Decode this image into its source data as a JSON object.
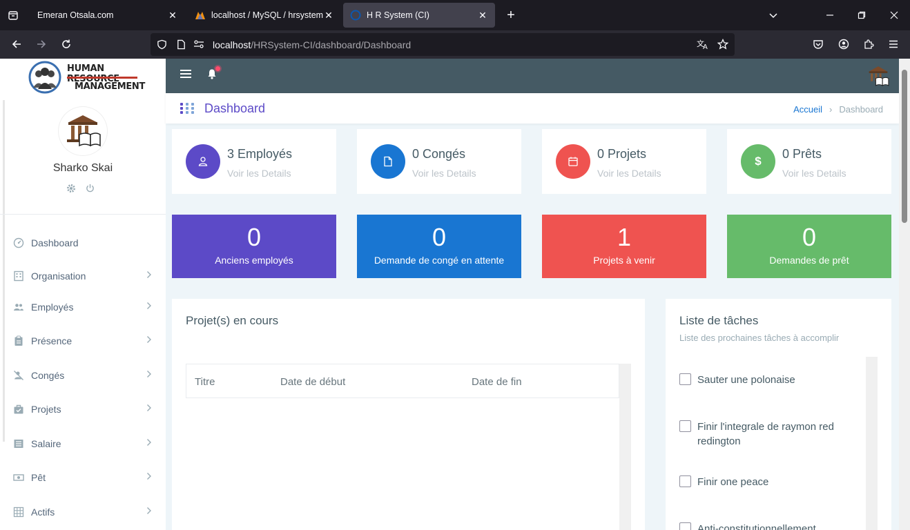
{
  "browser": {
    "tabs": [
      {
        "title": "Emeran Otsala.com",
        "active": false
      },
      {
        "title": "localhost / MySQL / hrsystemci",
        "active": false
      },
      {
        "title": "H R System (CI)",
        "active": true
      }
    ],
    "url_host": "localhost",
    "url_path": "/HRSystem-CI/dashboard/Dashboard"
  },
  "logo": {
    "line1": "HUMAN RESOURCE",
    "line2": "MANAGEMENT"
  },
  "user": {
    "name": "Sharko Skai"
  },
  "menu": [
    {
      "label": "Dashboard",
      "icon": "dashboard-icon",
      "has_arrow": false
    },
    {
      "label": "Organisation",
      "icon": "building-icon",
      "has_arrow": true
    },
    {
      "label": "Employés",
      "icon": "people-icon",
      "has_arrow": true
    },
    {
      "label": "Présence",
      "icon": "clipboard-icon",
      "has_arrow": true
    },
    {
      "label": "Congés",
      "icon": "user-off-icon",
      "has_arrow": true
    },
    {
      "label": "Projets",
      "icon": "briefcase-icon",
      "has_arrow": true
    },
    {
      "label": "Salaire",
      "icon": "list-icon",
      "has_arrow": true
    },
    {
      "label": "Pêt",
      "icon": "money-icon",
      "has_arrow": true
    },
    {
      "label": "Actifs",
      "icon": "grid-icon",
      "has_arrow": true
    }
  ],
  "page_title": "Dashboard",
  "breadcrumb": {
    "home": "Accueil",
    "current": "Dashboard"
  },
  "stats": [
    {
      "value": "3 Employés",
      "link": "Voir les Details",
      "color": "#5c4ac7",
      "icon": "user-icon"
    },
    {
      "value": "0 Congés",
      "link": "Voir les Details",
      "color": "#1976d2",
      "icon": "file-icon"
    },
    {
      "value": "0 Projets",
      "link": "Voir les Details",
      "color": "#ef5350",
      "icon": "calendar-icon"
    },
    {
      "value": "0 Prêts",
      "link": "Voir les Details",
      "color": "#66bb6a",
      "icon": "dollar-icon"
    }
  ],
  "big_cards": [
    {
      "number": "0",
      "label": "Anciens employés",
      "color": "#5c4ac7"
    },
    {
      "number": "0",
      "label": "Demande de congé en attente",
      "color": "#1976d2"
    },
    {
      "number": "1",
      "label": "Projets à venir",
      "color": "#ef5350"
    },
    {
      "number": "0",
      "label": "Demandes de prêt",
      "color": "#66bb6a"
    }
  ],
  "projects_panel": {
    "title": "Projet(s) en cours",
    "columns": [
      "Titre",
      "Date de début",
      "Date de fin"
    ]
  },
  "tasks_panel": {
    "title": "Liste de tâches",
    "subtitle": "Liste des prochaines tâches à accomplir",
    "tasks": [
      "Sauter une polonaise",
      "Finir l'integrale de raymon red redington",
      "Finir one peace",
      "Anti-constitutionnellement"
    ]
  }
}
